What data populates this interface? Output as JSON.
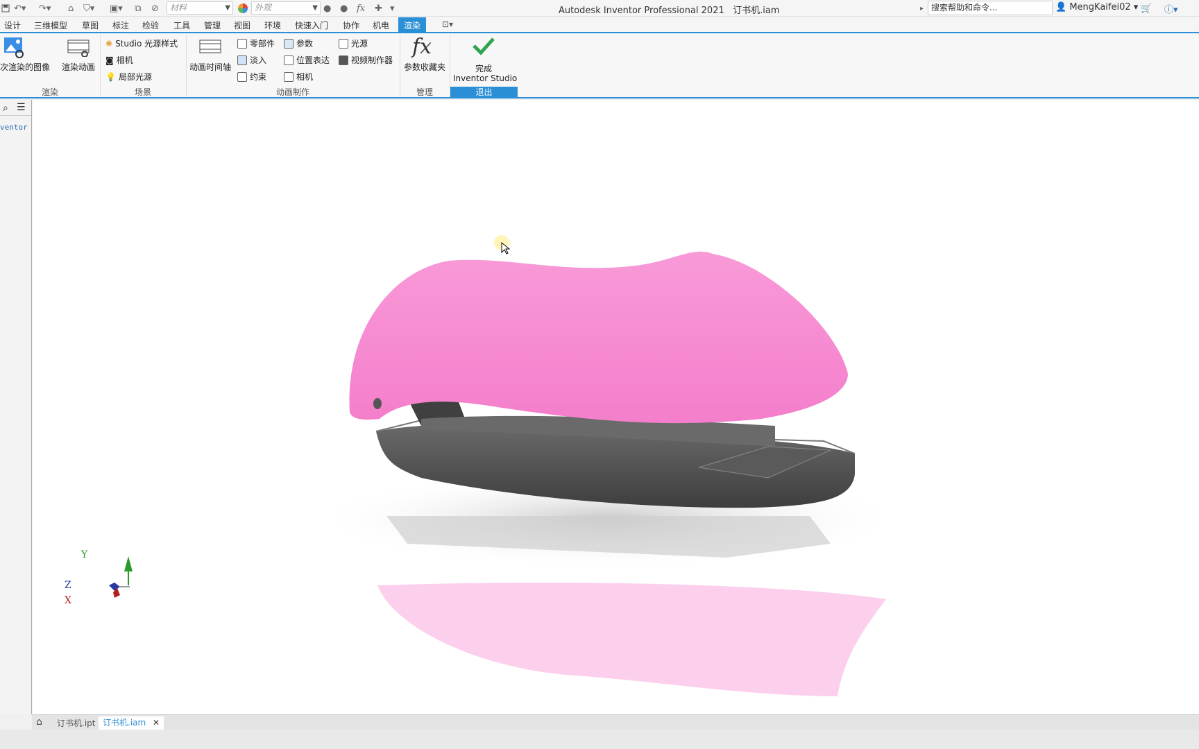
{
  "quick_access": {
    "material_placeholder": "材料",
    "appearance_placeholder": "外观",
    "fx_label": "fx"
  },
  "title": {
    "app": "Autodesk Inventor Professional 2021",
    "document": "订书机.iam"
  },
  "help_search": {
    "placeholder": "搜索帮助和命令..."
  },
  "user": {
    "name": "MengKaifei02"
  },
  "menu_tabs": [
    "设计",
    "三维模型",
    "草图",
    "标注",
    "检验",
    "工具",
    "管理",
    "视图",
    "环境",
    "快速入门",
    "协作",
    "机电",
    "渲染"
  ],
  "active_tab": "渲染",
  "ribbon": {
    "render_group": {
      "label": "渲染",
      "btn_image": "次渲染的图像",
      "btn_animation": "渲染动画"
    },
    "scene_group": {
      "label": "场景",
      "studio_lighting": "Studio 光源样式",
      "camera": "相机",
      "local_lights": "局部光源"
    },
    "animation_group": {
      "label": "动画制作",
      "timeline": "动画时间轴",
      "component": "零部件",
      "fade": "淡入",
      "constraint": "约束",
      "parameter": "参数",
      "pos_rep": "位置表达",
      "camera": "相机",
      "light": "光源",
      "video_producer": "视频制作器"
    },
    "manage_group": {
      "label": "管理",
      "param_favorites": "参数收藏夹"
    },
    "exit_group": {
      "label": "退出",
      "finish": "完成",
      "finish_sub": "Inventor Studio"
    }
  },
  "left_panel": {
    "browser_text": "ventor S"
  },
  "axes": {
    "x": "X",
    "y": "Y",
    "z": "Z"
  },
  "doc_tabs": [
    {
      "label": "订书机.ipt",
      "active": false
    },
    {
      "label": "订书机.iam",
      "active": true
    }
  ],
  "colors": {
    "accent": "#2b8fd6",
    "stapler_top": "#f98bd4",
    "stapler_base": "#555555"
  }
}
